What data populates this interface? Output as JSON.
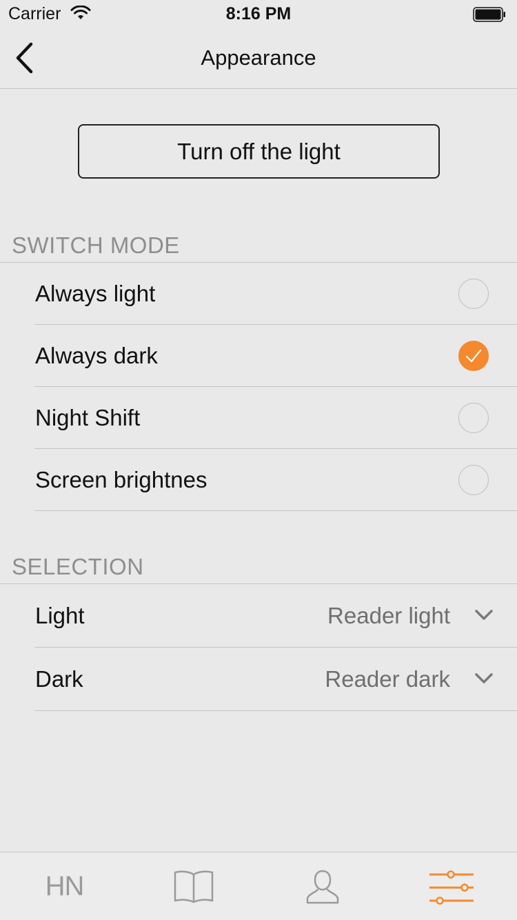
{
  "status_bar": {
    "carrier": "Carrier",
    "time": "8:16 PM"
  },
  "nav": {
    "title": "Appearance",
    "back_icon": "chevron-left-icon"
  },
  "light_button": {
    "label": "Turn off the light"
  },
  "switch_mode": {
    "header": "SWITCH MODE",
    "options": [
      {
        "label": "Always light",
        "selected": false
      },
      {
        "label": "Always dark",
        "selected": true
      },
      {
        "label": "Night Shift",
        "selected": false
      },
      {
        "label": "Screen brightnes",
        "selected": false
      }
    ]
  },
  "selection": {
    "header": "SELECTION",
    "rows": [
      {
        "label": "Light",
        "value": "Reader light"
      },
      {
        "label": "Dark",
        "value": "Reader dark"
      }
    ]
  },
  "tab_bar": {
    "tabs": [
      {
        "label": "HN",
        "icon": "hn-text-icon",
        "active": false
      },
      {
        "label": "",
        "icon": "book-icon",
        "active": false
      },
      {
        "label": "",
        "icon": "user-icon",
        "active": false
      },
      {
        "label": "",
        "icon": "sliders-icon",
        "active": true
      }
    ]
  },
  "colors": {
    "accent": "#f5892d",
    "background": "#e9e9e9",
    "separator": "#c4c4c4",
    "secondary_text": "#8e8e8e",
    "inactive_icon": "#9a9a9a"
  }
}
